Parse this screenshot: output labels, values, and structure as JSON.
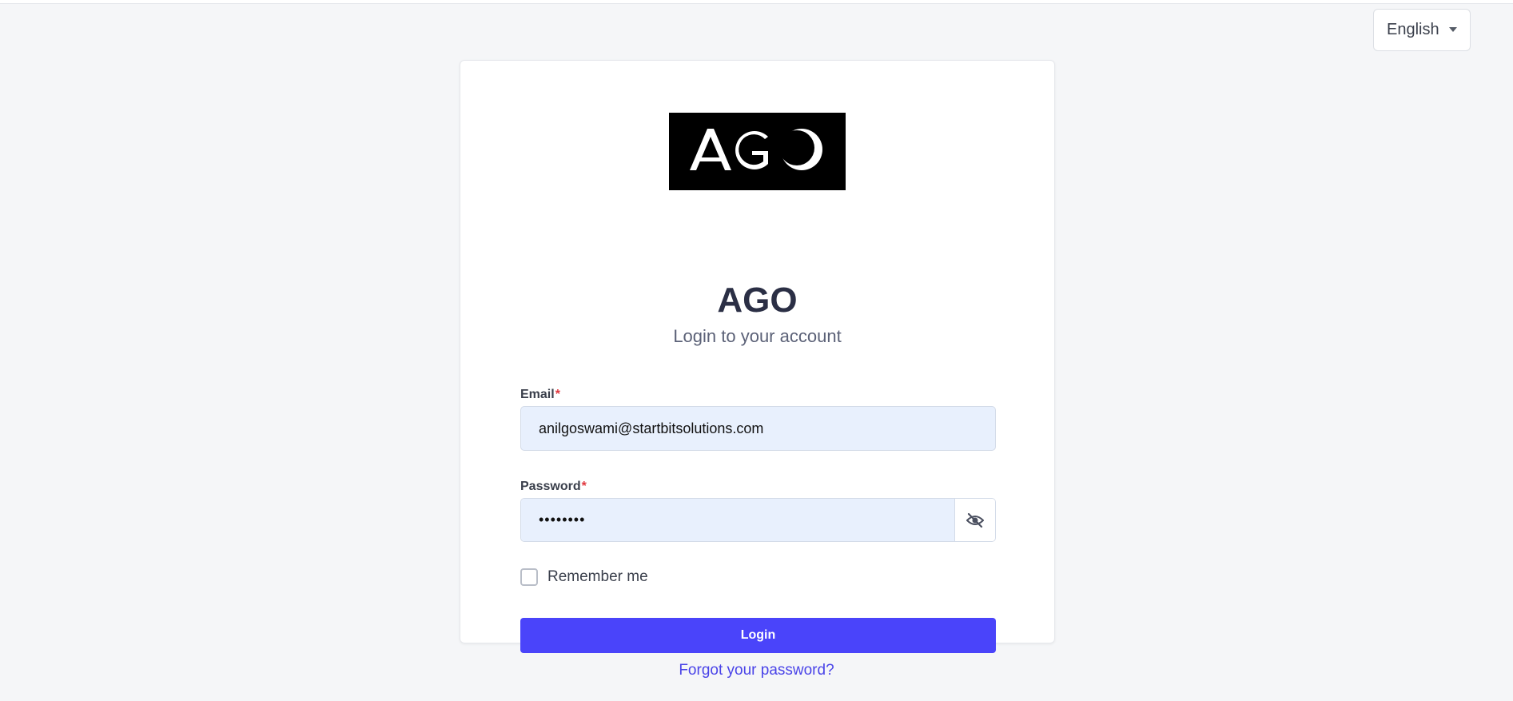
{
  "language_selector": {
    "value": "English",
    "caret_icon": "caret-down-icon"
  },
  "brand": {
    "logo_text": "AGO",
    "logo_background": "#000000",
    "title": "AGO",
    "subtitle": "Login to your account"
  },
  "form": {
    "email": {
      "label": "Email",
      "required_mark": "*",
      "value": "anilgoswami@startbitsolutions.com"
    },
    "password": {
      "label": "Password",
      "required_mark": "*",
      "value": "••••••••",
      "toggle_icon": "eye-off-icon"
    },
    "remember_me": {
      "label": "Remember me",
      "checked": false
    },
    "login_button": "Login"
  },
  "forgot_password_link": "Forgot your password?",
  "colors": {
    "accent": "#4a44fa",
    "link": "#4a44e8",
    "required": "#e0363d",
    "input_fill": "#e8f0fd",
    "page_background": "#f5f6f8"
  }
}
